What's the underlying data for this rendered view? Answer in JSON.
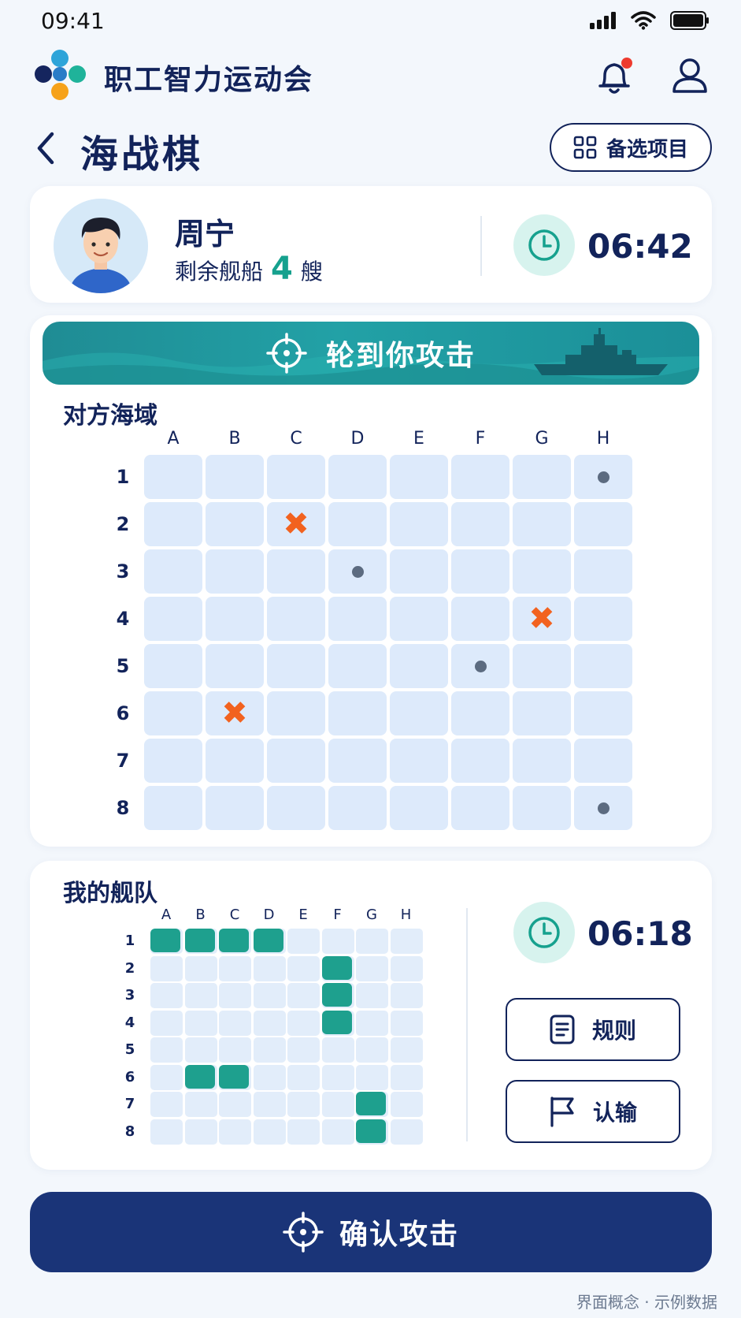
{
  "status_bar": {
    "time": "09:41"
  },
  "app": {
    "title": "职工智力运动会"
  },
  "page": {
    "title": "海战棋",
    "alt_button": "备选项目"
  },
  "player": {
    "name": "周宁",
    "ships_prefix": "剩余舰船",
    "ships_count": "4",
    "ships_unit": "艘",
    "timer": "06:42"
  },
  "banner": {
    "text": "轮到你攻击"
  },
  "opponent_board": {
    "title": "对方海域",
    "columns": [
      "A",
      "B",
      "C",
      "D",
      "E",
      "F",
      "G",
      "H"
    ],
    "rows": [
      "1",
      "2",
      "3",
      "4",
      "5",
      "6",
      "7",
      "8"
    ],
    "hits": [
      [
        "C",
        "2"
      ],
      [
        "G",
        "4"
      ],
      [
        "B",
        "6"
      ]
    ],
    "misses": [
      [
        "H",
        "1"
      ],
      [
        "D",
        "3"
      ],
      [
        "F",
        "5"
      ],
      [
        "H",
        "8"
      ]
    ]
  },
  "fleet": {
    "title": "我的舰队",
    "columns": [
      "A",
      "B",
      "C",
      "D",
      "E",
      "F",
      "G",
      "H"
    ],
    "rows": [
      "1",
      "2",
      "3",
      "4",
      "5",
      "6",
      "7",
      "8"
    ],
    "ships": [
      {
        "start": [
          "A",
          "1"
        ],
        "length": 4,
        "orientation": "horizontal"
      },
      {
        "start": [
          "F",
          "2"
        ],
        "length": 3,
        "orientation": "vertical"
      },
      {
        "start": [
          "B",
          "6"
        ],
        "length": 2,
        "orientation": "horizontal"
      },
      {
        "start": [
          "G",
          "7"
        ],
        "length": 2,
        "orientation": "vertical"
      }
    ],
    "timer": "06:18",
    "rules_button": "规则",
    "resign_button": "认输"
  },
  "confirm_button": "确认攻击",
  "footnote": "界面概念 · 示例数据",
  "colors": {
    "primary": "#1a3478",
    "accent": "#1ea08e",
    "hit": "#f2621f",
    "miss": "#5c6b80"
  }
}
